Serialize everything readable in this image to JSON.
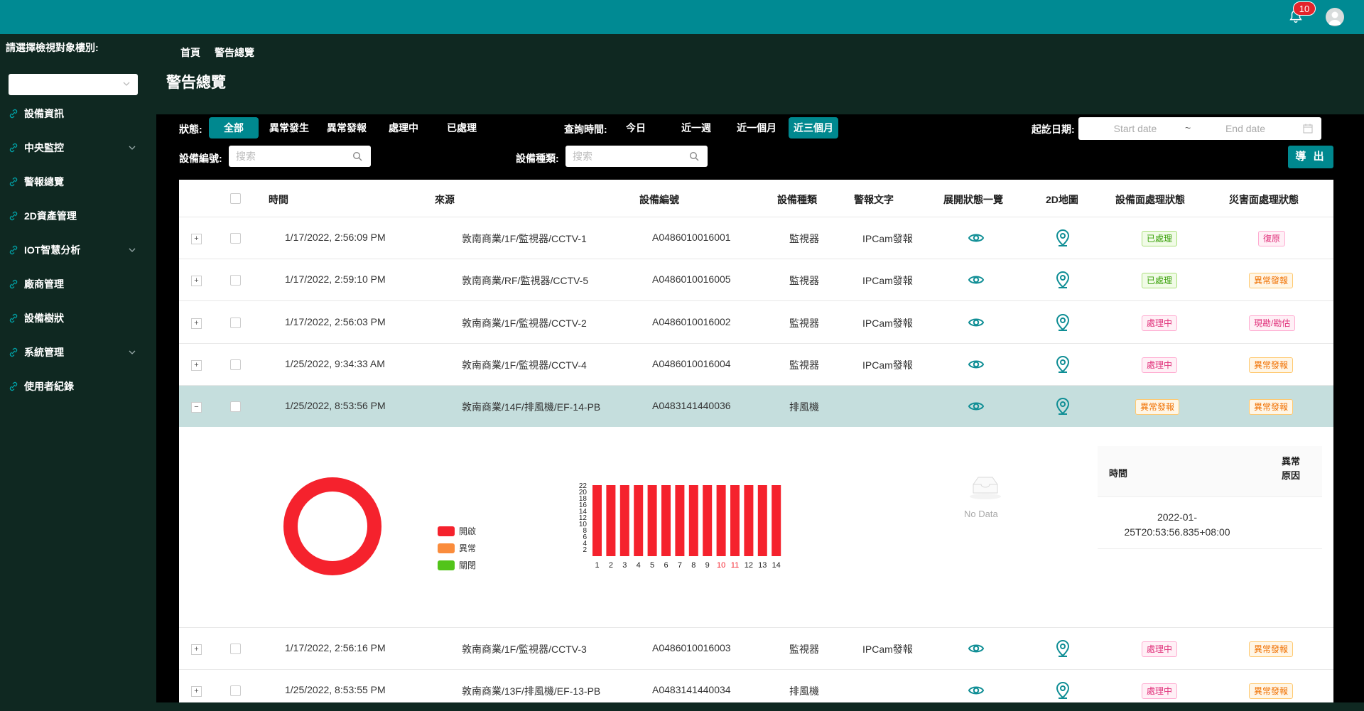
{
  "header": {
    "notification_count": "10"
  },
  "sidebar": {
    "target_label": "請選擇檢視對象樓別:",
    "select_value": "",
    "items": [
      {
        "label": "設備資訊",
        "has_arrow": false
      },
      {
        "label": "中央監控",
        "has_arrow": true
      },
      {
        "label": "警報總覽",
        "has_arrow": false
      },
      {
        "label": "2D資產管理",
        "has_arrow": false
      },
      {
        "label": "IOT智慧分析",
        "has_arrow": true
      },
      {
        "label": "廠商管理",
        "has_arrow": false
      },
      {
        "label": "設備樹狀",
        "has_arrow": false
      },
      {
        "label": "系統管理",
        "has_arrow": true
      },
      {
        "label": "使用者紀錄",
        "has_arrow": false
      }
    ]
  },
  "breadcrumb": {
    "home": "首頁",
    "current": "警告總覽"
  },
  "page_title": "警告總覽",
  "filters": {
    "status_label": "狀態:",
    "status_options": [
      "全部",
      "異常發生",
      "異常發報",
      "處理中",
      "已處理"
    ],
    "status_selected": "全部",
    "time_label": "查詢時間:",
    "time_options": [
      "今日",
      "近一週",
      "近一個月",
      "近三個月"
    ],
    "time_selected": "近三個月",
    "date_label": "起訖日期:",
    "start_placeholder": "Start date",
    "end_placeholder": "End date",
    "date_separator": "~",
    "device_no_label": "設備編號:",
    "device_no_placeholder": "搜索",
    "device_type_label": "設備種類:",
    "device_type_placeholder": "搜索",
    "export_label": "導 出"
  },
  "table": {
    "headers": {
      "time": "時間",
      "source": "來源",
      "device_no": "設備編號",
      "device_type": "設備種類",
      "alarm_text": "警報文字",
      "expand_status": "展開狀態一覽",
      "map2d": "2D地圖",
      "device_status": "設備面處理狀態",
      "disaster_status": "災害面處理狀態"
    },
    "rows": [
      {
        "time": "1/17/2022, 2:56:09 PM",
        "source": "敦南商業/1F/監視器/CCTV-1",
        "device_no": "A0486010016001",
        "device_type": "監視器",
        "alarm_text": "IPCam發報",
        "device_status": "已處理",
        "device_status_color": "green",
        "disaster_status": "復原",
        "disaster_status_color": "pink"
      },
      {
        "time": "1/17/2022, 2:59:10 PM",
        "source": "敦南商業/RF/監視器/CCTV-5",
        "device_no": "A0486010016005",
        "device_type": "監視器",
        "alarm_text": "IPCam發報",
        "device_status": "已處理",
        "device_status_color": "green",
        "disaster_status": "異常發報",
        "disaster_status_color": "orange"
      },
      {
        "time": "1/17/2022, 2:56:03 PM",
        "source": "敦南商業/1F/監視器/CCTV-2",
        "device_no": "A0486010016002",
        "device_type": "監視器",
        "alarm_text": "IPCam發報",
        "device_status": "處理中",
        "device_status_color": "pink",
        "disaster_status": "現勘/勘估",
        "disaster_status_color": "pink"
      },
      {
        "time": "1/25/2022, 9:34:33 AM",
        "source": "敦南商業/1F/監視器/CCTV-4",
        "device_no": "A0486010016004",
        "device_type": "監視器",
        "alarm_text": "IPCam發報",
        "device_status": "處理中",
        "device_status_color": "pink",
        "disaster_status": "異常發報",
        "disaster_status_color": "orange"
      },
      {
        "time": "1/25/2022, 8:53:56 PM",
        "source": "敦南商業/14F/排風機/EF-14-PB",
        "device_no": "A0483141440036",
        "device_type": "排風機",
        "alarm_text": "",
        "device_status": "異常發報",
        "device_status_color": "orange",
        "disaster_status": "異常發報",
        "disaster_status_color": "orange",
        "expanded": true
      },
      {
        "time": "1/17/2022, 2:56:16 PM",
        "source": "敦南商業/1F/監視器/CCTV-3",
        "device_no": "A0486010016003",
        "device_type": "監視器",
        "alarm_text": "IPCam發報",
        "device_status": "處理中",
        "device_status_color": "pink",
        "disaster_status": "異常發報",
        "disaster_status_color": "orange"
      },
      {
        "time": "1/25/2022, 8:53:55 PM",
        "source": "敦南商業/13F/排風機/EF-13-PB",
        "device_no": "A0483141440034",
        "device_type": "排風機",
        "alarm_text": "",
        "device_status": "處理中",
        "device_status_color": "pink",
        "disaster_status": "異常發報",
        "disaster_status_color": "orange"
      }
    ]
  },
  "expanded_detail": {
    "legend": [
      {
        "label": "開啟",
        "color": "#f5222d"
      },
      {
        "label": "異常",
        "color": "#fa8c3c"
      },
      {
        "label": "關閉",
        "color": "#52c41a"
      }
    ],
    "no_data_text": "No Data",
    "inner_table": {
      "header_time": "時間",
      "header_reason": "異常原因",
      "rows": [
        {
          "time": "2022-01-25T20:53:56.835+08:00"
        }
      ]
    }
  },
  "chart_data": [
    {
      "type": "pie",
      "labels": [
        "開啟"
      ],
      "values": [
        100
      ],
      "colors": [
        "#f5222d"
      ]
    },
    {
      "type": "bar",
      "categories": [
        "1",
        "2",
        "3",
        "4",
        "5",
        "6",
        "7",
        "8",
        "9",
        "10",
        "11",
        "12",
        "13",
        "14"
      ],
      "highlighted_categories": [
        "10",
        "11"
      ],
      "values": [
        22,
        22,
        22,
        22,
        22,
        22,
        22,
        22,
        22,
        22,
        22,
        22,
        22,
        22
      ],
      "y_ticks": [
        "22",
        "20",
        "18",
        "16",
        "14",
        "12",
        "10",
        "8",
        "6",
        "4",
        "2"
      ],
      "ylim": [
        0,
        22
      ],
      "bar_color": "#f5222d"
    }
  ]
}
